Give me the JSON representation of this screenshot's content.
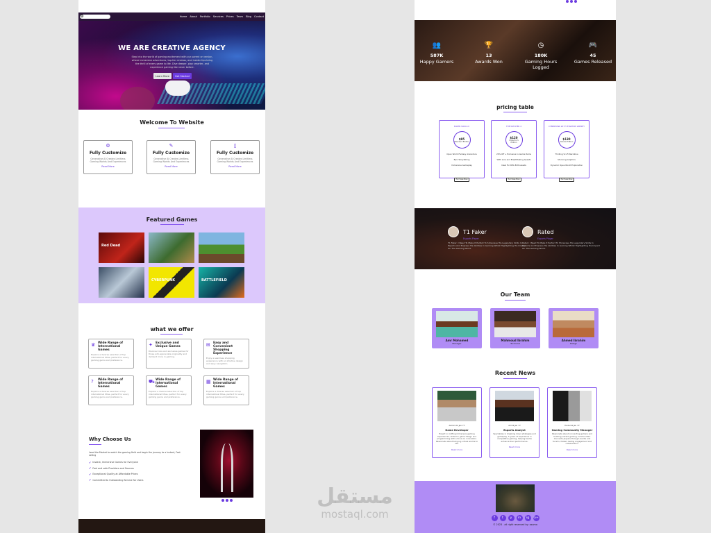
{
  "nav": {
    "items": [
      "Home",
      "About",
      "Portfolio",
      "Services",
      "Prices",
      "Team",
      "Blog",
      "Contact"
    ]
  },
  "hero": {
    "title": "WE ARE CREATIVE AGENCY",
    "text": "Step into the world of gaming excitement with our parent or version, where immersive adventures, top-tier reviews, and insider tips bring the thrill of every game to life. Dive deeper, play smarter, and experience gaming like never before.",
    "learn": "Learn More",
    "start": "Get Started"
  },
  "welcome": {
    "title": "Welcome To Website",
    "cards": [
      {
        "title": "Fully Customize",
        "text": "Generative AI Creates Limitless Gaming Worlds And Experiences",
        "link": "Read More"
      },
      {
        "title": "Fully Customize",
        "text": "Generative AI Creates Limitless Gaming Worlds And Experiences",
        "link": "Read More"
      },
      {
        "title": "Fully Customize",
        "text": "Generative AI Creates Limitless Gaming Worlds And Experiences",
        "link": "Read More"
      }
    ]
  },
  "featured": {
    "title": "Featured Games",
    "games": [
      "Red Dead",
      "",
      "",
      "",
      "CYBERPUNK",
      "BATTLEFIELD"
    ]
  },
  "offer": {
    "title": "what we offer",
    "cards": [
      {
        "title": "Wide Range of International Games",
        "text": "Explore a diverse selection of top international titles, perfect for every gaming genre and preference."
      },
      {
        "title": "Exclusive and Unique Games",
        "text": "Discover rare and exclusive games for those who appreciate originality and demand more in gaming."
      },
      {
        "title": "Easy and Convenient Shopping Experience",
        "text": "Enjoy a seamless shopping experience with an intuitive design and easy navigation."
      },
      {
        "title": "Wide Range of International Games",
        "text": "Explore a diverse selection of top international titles, perfect for every gaming genre and preference."
      },
      {
        "title": "Wide Range of International Games",
        "text": "Explore a diverse selection of top international titles, perfect for every gaming genre and preference."
      },
      {
        "title": "Wide Range of International Games",
        "text": "Explore a diverse selection of top international titles, perfect for every gaming genre and preference."
      }
    ]
  },
  "why": {
    "title": "Why Choose Us",
    "sub": "Lead the Market to watch the gaming field and begin the journey to a Instant, Fast selling",
    "items": [
      "Instant, Immersive Games for Everyone",
      "Fast and safe Providers and Sources",
      "Exceptional Quality at Affordable Prices",
      "Committed to Outstanding Service for Users"
    ]
  },
  "stats": [
    {
      "icon": "users-icon",
      "value": "587K",
      "label": "Happy Gamers"
    },
    {
      "icon": "trophy-icon",
      "value": "13",
      "label": "Awards Won"
    },
    {
      "icon": "clock-icon",
      "value": "180K",
      "label": "Gaming Hours Logged"
    },
    {
      "icon": "gamepad-icon",
      "value": "45",
      "label": "Games Released"
    }
  ],
  "pricing": {
    "title": "pricing table",
    "plans": [
      {
        "name": "ELDEN SOULS II",
        "price": "$95",
        "note": "Standard Edition",
        "features": [
          "Open World Fantasy Adventure",
          "Epic Storytelling",
          "Immersive Gameplay"
        ],
        "button": "Purchase Now"
      },
      {
        "name": "THE WITCHER 4",
        "price": "$120",
        "note": "Collector's Edition",
        "features": [
          "20% Off + Exclusive In-Game Items",
          "With Lore and Breathtaking Quests",
          "Ideal For RPG Enthusiasts"
        ],
        "button": "Purchase Now"
      },
      {
        "name": "CYBERPUNK 2077 PHANTOM LIBERTY",
        "price": "$130",
        "note": "Deluxe Edition",
        "features": [
          "Thrilling Sci-Fi Narrative",
          "Stunning Graphics",
          "Dynamic Open-World Exploration"
        ],
        "button": "Purchase Now"
      }
    ]
  },
  "testimonials": [
    {
      "name": "T1 Faker",
      "role": "Esports Player",
      "text": "T1 Faker: I Need To Make It Perfect To Showcase His Legendary Skills In Esports And Express His Abilities In Gaming Whilst Highlighting His Impact On The Gaming World."
    },
    {
      "name": "Rated",
      "role": "Esports Player",
      "text": "Rated: I Need To Make It Perfect To Showcase His Legendary Skills In Esports And Express His Abilities In Gaming Whilst Highlighting His Impact On The Gaming World."
    }
  ],
  "team": {
    "title": "Our Team",
    "members": [
      {
        "name": "Amr Mohamed",
        "role": "Manager"
      },
      {
        "name": "Mahmoud Ibrahim",
        "role": "Technical"
      },
      {
        "name": "Ahmed Ibrahim",
        "role": "Design"
      }
    ]
  },
  "news": {
    "title": "Recent News",
    "items": [
      {
        "meta": "Admin  04 Jan  77",
        "title": "Game Developer",
        "text": "Expert in crafting immersive gaming experiences, skilled in game design and programming with a focus on innovation. Passionate about bringing virtual worlds to life.",
        "link": "Read more"
      },
      {
        "meta": "Ali  04 Jan  77",
        "title": "Esports Analyst",
        "text": "Specializes in breaking down strategies and gameplay, 5 years of experience in competitive gaming, helping teams enhance their performance.",
        "link": "Read more"
      },
      {
        "meta": "Hoda  04 Jan  77",
        "title": "Gaming Community Manager",
        "text": "Passionate about connecting gamers and building vibrant gaming communities. Connects players through events and forums, fosters lasting engagement and collaboration.",
        "link": "Read more"
      }
    ]
  },
  "footer": {
    "copy": "© 2023 . all right reserved by: osama",
    "social": [
      "f",
      "t",
      "y",
      "in",
      "ig",
      "G+"
    ]
  },
  "watermark": {
    "ar": "مستقل",
    "en": "mostaql.com"
  }
}
